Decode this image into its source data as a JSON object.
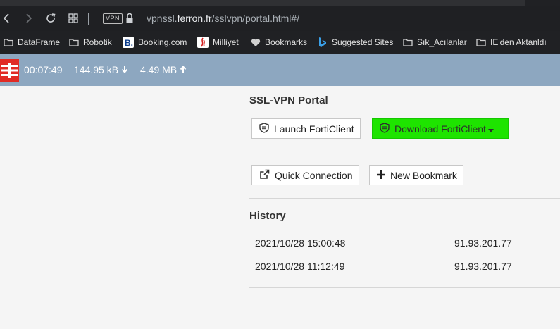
{
  "browser": {
    "vpn_badge": "VPN",
    "url_prefix": "vpnssl.",
    "url_host": "ferron.fr",
    "url_path": "/sslvpn/portal.html#/"
  },
  "bookmarks": [
    {
      "label": "DataFrame",
      "icon": "folder-icon"
    },
    {
      "label": "Robotik",
      "icon": "folder-icon"
    },
    {
      "label": "Booking.com",
      "icon": "booking-icon"
    },
    {
      "label": "Milliyet",
      "icon": "milliyet-icon"
    },
    {
      "label": "Bookmarks",
      "icon": "heart-icon"
    },
    {
      "label": "Suggested Sites",
      "icon": "bing-icon"
    },
    {
      "label": "Sık_Acılanlar",
      "icon": "folder-icon"
    },
    {
      "label": "IE'den Aktanldı",
      "icon": "folder-icon"
    }
  ],
  "status": {
    "duration": "00:07:49",
    "received": "144.95 kB",
    "sent": "4.49 MB"
  },
  "portal": {
    "title": "SSL-VPN Portal",
    "launch_label": "Launch FortiClient",
    "download_label": "Download FortiClient",
    "quick_connection_label": "Quick Connection",
    "new_bookmark_label": "New Bookmark"
  },
  "history": {
    "title": "History",
    "rows": [
      {
        "date": "2021/10/28 15:00:48",
        "ip": "91.93.201.77"
      },
      {
        "date": "2021/10/28 11:12:49",
        "ip": "91.93.201.77"
      }
    ]
  },
  "colors": {
    "status_bar": "#8da7c0",
    "forti_red": "#e12b25",
    "download_green": "#1ee400"
  }
}
